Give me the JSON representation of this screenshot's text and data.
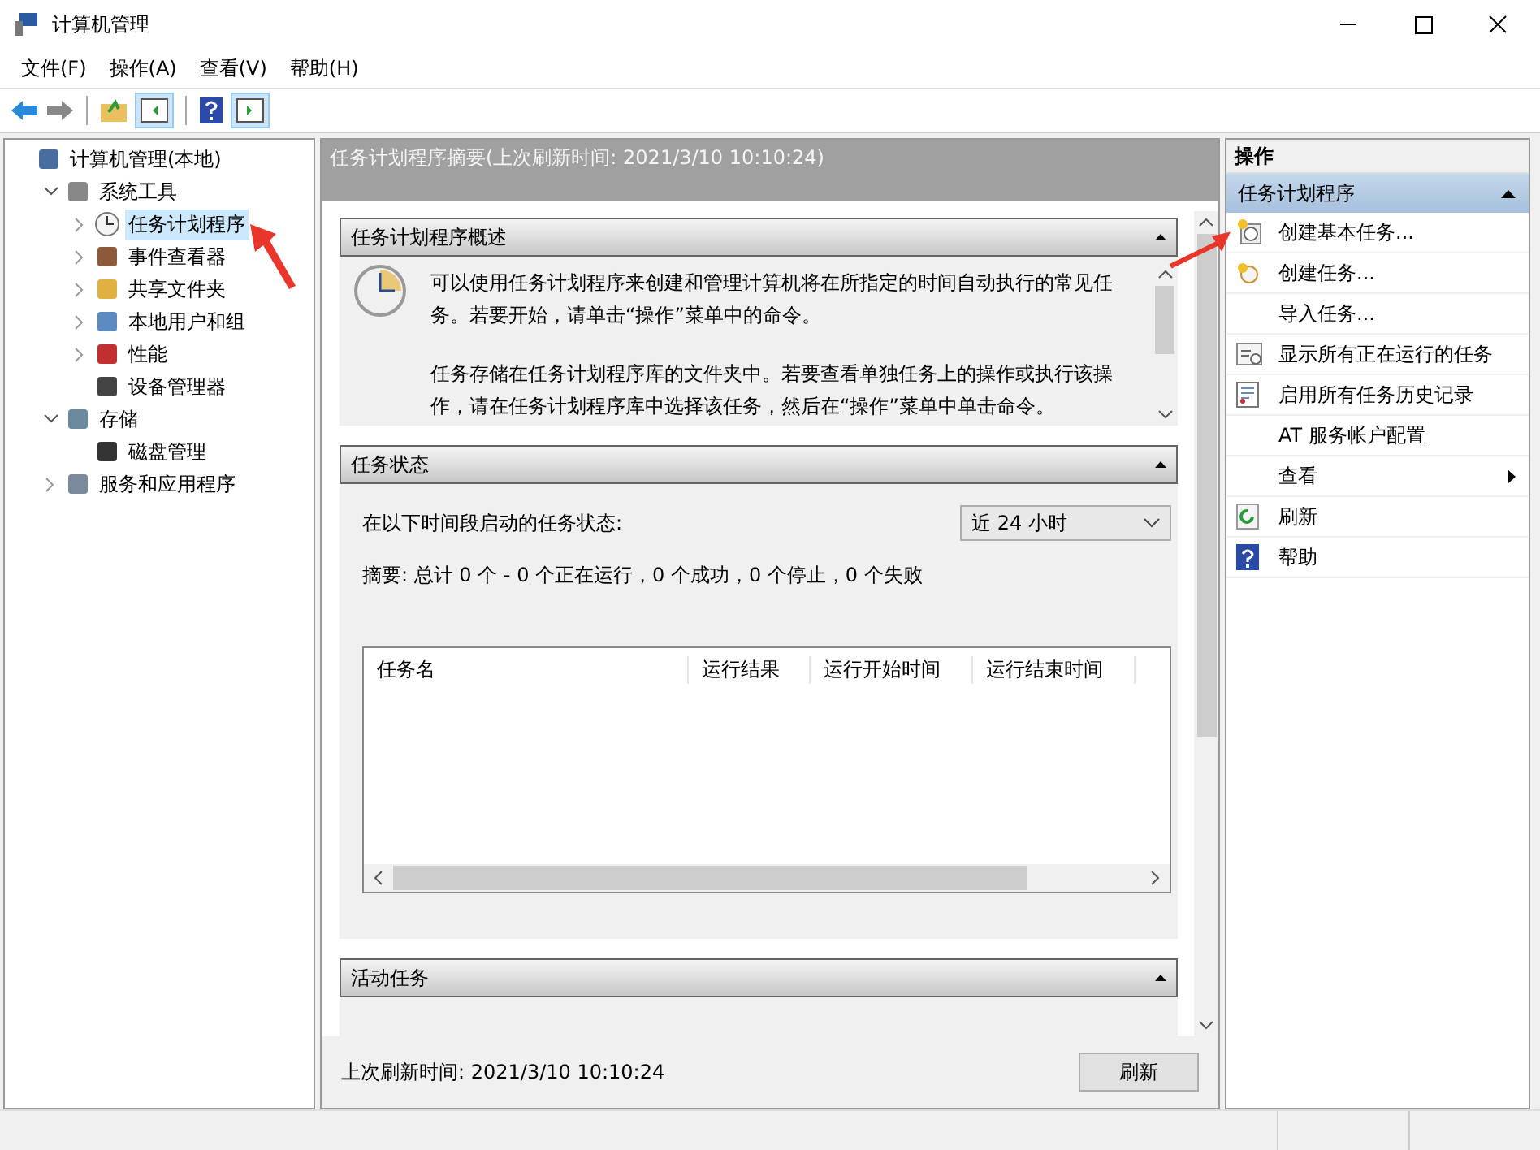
{
  "window": {
    "title": "计算机管理"
  },
  "menu": [
    "文件(F)",
    "操作(A)",
    "查看(V)",
    "帮助(H)"
  ],
  "tree": [
    {
      "label": "计算机管理(本地)",
      "kind": "computer",
      "selected": false,
      "children": [
        {
          "label": "系统工具",
          "kind": "tools",
          "expanded": true,
          "selected": false,
          "children": [
            {
              "label": "任务计划程序",
              "kind": "clock",
              "expanded": false,
              "selected": true
            },
            {
              "label": "事件查看器",
              "kind": "event",
              "expanded": false,
              "selected": false
            },
            {
              "label": "共享文件夹",
              "kind": "share",
              "expanded": false,
              "selected": false
            },
            {
              "label": "本地用户和组",
              "kind": "users",
              "expanded": false,
              "selected": false
            },
            {
              "label": "性能",
              "kind": "perf",
              "expanded": false,
              "selected": false
            },
            {
              "label": "设备管理器",
              "kind": "device",
              "selected": false
            }
          ]
        },
        {
          "label": "存储",
          "kind": "storage",
          "expanded": true,
          "selected": false,
          "children": [
            {
              "label": "磁盘管理",
              "kind": "disk",
              "selected": false
            }
          ]
        },
        {
          "label": "服务和应用程序",
          "kind": "services",
          "expanded": false,
          "selected": false
        }
      ]
    }
  ],
  "center": {
    "header": "任务计划程序摘要(上次刷新时间: 2021/3/10 10:10:24)",
    "overview": {
      "title": "任务计划程序概述",
      "paragraphs": [
        "可以使用任务计划程序来创建和管理计算机将在所指定的时间自动执行的常见任务。若要开始，请单击“操作”菜单中的命令。",
        "任务存储在任务计划程序库的文件夹中。若要查看单独任务上的操作或执行该操作，请在任务计划程序库中选择该任务，然后在“操作”菜单中单击命令。"
      ]
    },
    "status": {
      "title": "任务状态",
      "period_label": "在以下时间段启动的任务状态:",
      "period": "近 24 小时",
      "summary": "摘要: 总计 0 个 - 0 个正在运行，0 个成功，0 个停止，0 个失败",
      "columns": [
        "任务名",
        "运行结果",
        "运行开始时间",
        "运行结束时间"
      ]
    },
    "active": {
      "title": "活动任务"
    },
    "footer": {
      "refresh_time": "上次刷新时间: 2021/3/10 10:10:24",
      "refresh_button": "刷新"
    }
  },
  "actions": {
    "header": "操作",
    "group": "任务计划程序",
    "items": [
      {
        "label": "创建基本任务...",
        "kind": "basic-task"
      },
      {
        "label": "创建任务...",
        "kind": "task"
      },
      {
        "label": "导入任务...",
        "kind": "plain"
      },
      {
        "label": "显示所有正在运行的任务",
        "kind": "running"
      },
      {
        "label": "启用所有任务历史记录",
        "kind": "history"
      },
      {
        "label": "AT 服务帐户配置",
        "kind": "plain"
      },
      {
        "label": "查看",
        "kind": "submenu"
      },
      {
        "label": "刷新",
        "kind": "refresh"
      },
      {
        "label": "帮助",
        "kind": "help"
      }
    ]
  }
}
